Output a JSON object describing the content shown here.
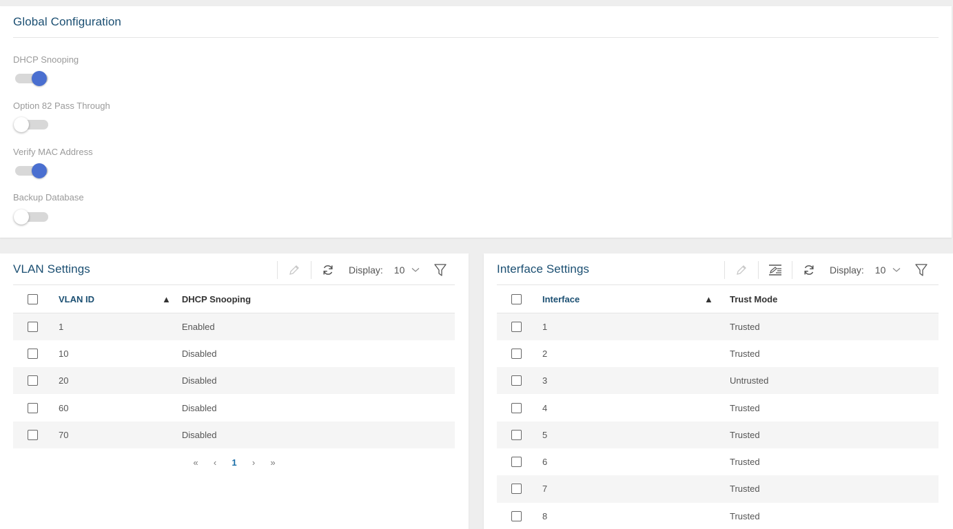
{
  "global": {
    "title": "Global Configuration",
    "settings": [
      {
        "label": "DHCP Snooping",
        "on": true
      },
      {
        "label": "Option 82 Pass Through",
        "on": false
      },
      {
        "label": "Verify MAC Address",
        "on": true
      },
      {
        "label": "Backup Database",
        "on": false
      }
    ]
  },
  "vlan": {
    "title": "VLAN Settings",
    "display_label": "Display:",
    "display_value": "10",
    "columns": [
      "VLAN ID",
      "DHCP Snooping"
    ],
    "sort_indicator": "▲",
    "rows": [
      {
        "id": "1",
        "status": "Enabled"
      },
      {
        "id": "10",
        "status": "Disabled"
      },
      {
        "id": "20",
        "status": "Disabled"
      },
      {
        "id": "60",
        "status": "Disabled"
      },
      {
        "id": "70",
        "status": "Disabled"
      }
    ],
    "pager": {
      "first": "«",
      "prev": "‹",
      "current": "1",
      "next": "›",
      "last": "»"
    }
  },
  "iface": {
    "title": "Interface Settings",
    "display_label": "Display:",
    "display_value": "10",
    "columns": [
      "Interface",
      "Trust Mode"
    ],
    "sort_indicator": "▲",
    "rows": [
      {
        "id": "1",
        "mode": "Trusted"
      },
      {
        "id": "2",
        "mode": "Trusted"
      },
      {
        "id": "3",
        "mode": "Untrusted"
      },
      {
        "id": "4",
        "mode": "Trusted"
      },
      {
        "id": "5",
        "mode": "Trusted"
      },
      {
        "id": "6",
        "mode": "Trusted"
      },
      {
        "id": "7",
        "mode": "Trusted"
      },
      {
        "id": "8",
        "mode": "Trusted"
      }
    ]
  },
  "icons": {
    "edit": "pencil-icon",
    "refresh": "refresh-icon",
    "filter": "filter-icon",
    "dropdown": "chevron-down-icon",
    "bulk_edit": "bulk-edit-icon"
  },
  "colors": {
    "accent": "#4a6fd0",
    "title": "#1b4f72",
    "stripe": "#f5f5f5"
  }
}
